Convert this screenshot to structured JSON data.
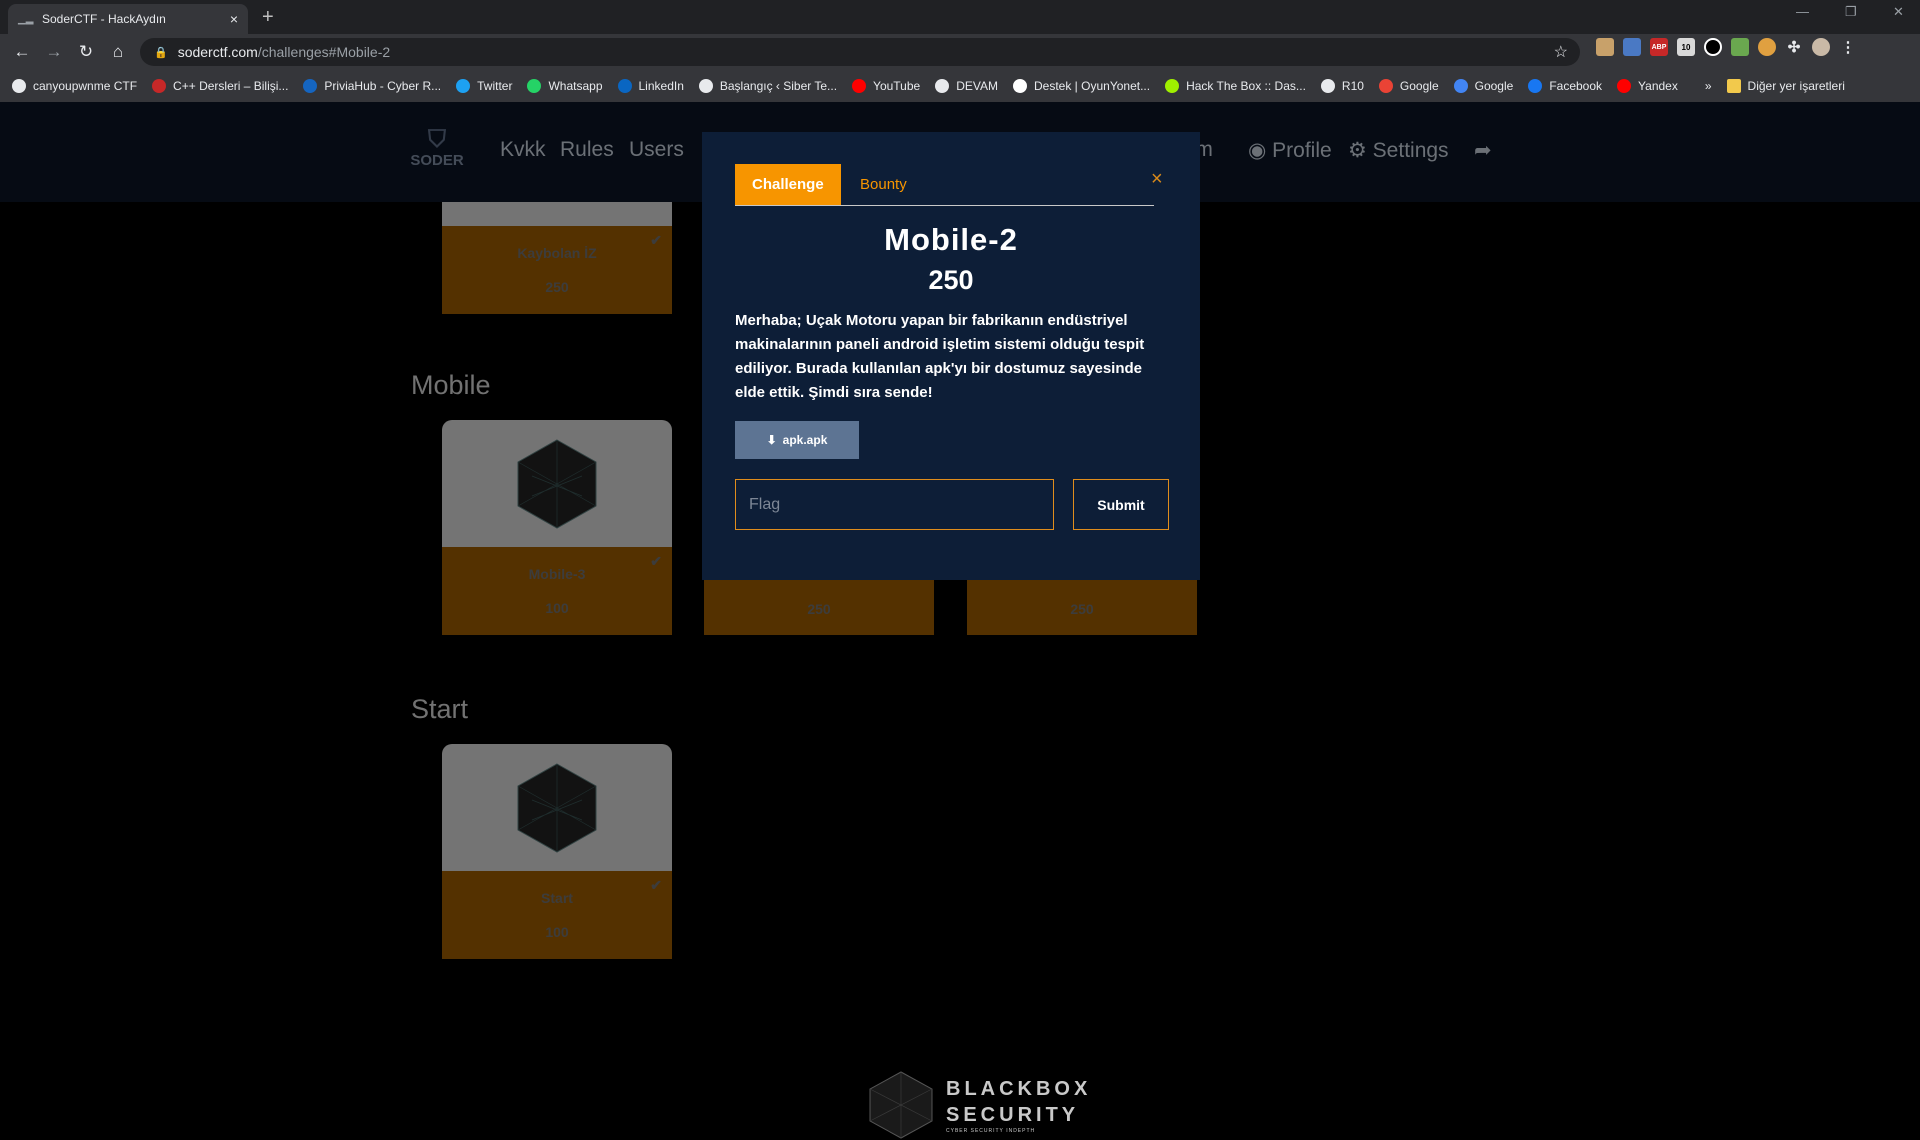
{
  "browser": {
    "tab_title": "SoderCTF - HackAydın",
    "tab_close": "×",
    "new_tab": "+",
    "url_host": "soderctf.com",
    "url_path": "/challenges#Mobile-2",
    "ext_abp": "ABP",
    "ext_badge": "10"
  },
  "bookmarks": [
    {
      "label": "canyoupwnme CTF",
      "color": "#e8eaed"
    },
    {
      "label": "C++ Dersleri – Bilişi...",
      "color": "#c62828"
    },
    {
      "label": "PriviaHub - Cyber R...",
      "color": "#1565c0"
    },
    {
      "label": "Twitter",
      "color": "#1da1f2"
    },
    {
      "label": "Whatsapp",
      "color": "#25d366"
    },
    {
      "label": "LinkedIn",
      "color": "#0a66c2"
    },
    {
      "label": "Başlangıç ‹ Siber Te...",
      "color": "#e8eaed"
    },
    {
      "label": "YouTube",
      "color": "#ff0000"
    },
    {
      "label": "DEVAM",
      "color": "#e8eaed"
    },
    {
      "label": "Destek | OyunYonet...",
      "color": "#ffffff"
    },
    {
      "label": "Hack The Box :: Das...",
      "color": "#9fef00"
    },
    {
      "label": "R10",
      "color": "#e8eaed"
    },
    {
      "label": "Google",
      "color": "#ea4335"
    },
    {
      "label": "Google",
      "color": "#4285f4"
    },
    {
      "label": "Facebook",
      "color": "#1877f2"
    },
    {
      "label": "Yandex",
      "color": "#ff0000"
    }
  ],
  "bookmarks_more": "»",
  "bookmarks_other": "Diğer yer işaretleri",
  "site": {
    "logo_text": "SODER",
    "nav": {
      "kvkk": "Kvkk",
      "rules": "Rules",
      "users": "Users",
      "team_partial": "eam",
      "profile": "Profile",
      "settings": "Settings"
    },
    "sections": {
      "mobile": "Mobile",
      "start": "Start"
    },
    "cards": {
      "kaybolan": {
        "name": "Kaybolan İZ",
        "points": "250"
      },
      "mobile3": {
        "name": "Mobile-3",
        "points": "100"
      },
      "mobile_mid": {
        "points": "250"
      },
      "mobile_right": {
        "points": "250"
      },
      "start": {
        "name": "Start",
        "points": "100"
      }
    },
    "footer_logo": {
      "line1": "BLACKBOX",
      "line2": "SECURITY",
      "tagline": "CYBER SECURITY INDEPTH"
    }
  },
  "modal": {
    "tab_challenge": "Challenge",
    "tab_bounty": "Bounty",
    "close": "×",
    "name": "Mobile-2",
    "value": "250",
    "description": "Merhaba; Uçak Motoru yapan bir fabrikanın endüstriyel makinalarının paneli android işletim sistemi olduğu tespit ediliyor. Burada kullanılan apk'yı bir dostumuz sayesinde elde ettik. Şimdi sıra sende!",
    "file_label": "apk.apk",
    "flag_placeholder": "Flag",
    "submit_label": "Submit"
  },
  "colors": {
    "accent": "#f79500",
    "modal_bg": "#0d1e37",
    "card_foot": "#9a5a00"
  }
}
